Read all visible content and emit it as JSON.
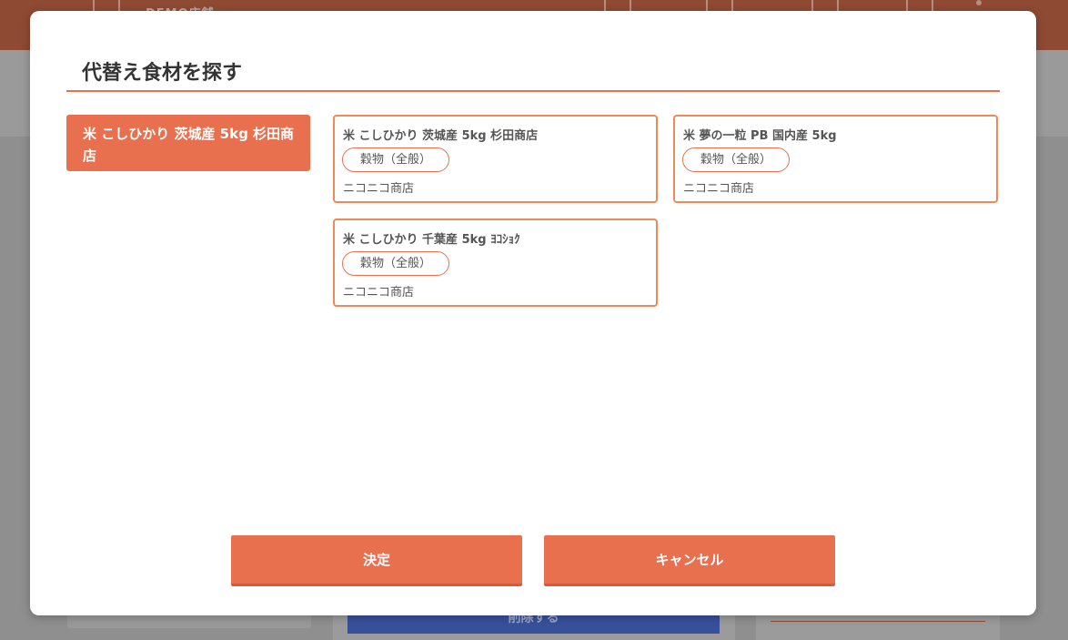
{
  "background": {
    "logo_text": "DEMO店舗",
    "delete_button_label": "削除する"
  },
  "modal": {
    "title": "代替え食材を探す",
    "selected_item": "米 こしひかり 茨城産 5kg 杉田商店",
    "cards": [
      {
        "name": "米 こしひかり 茨城産 5kg 杉田商店",
        "category": "穀物（全般）",
        "shop": "ニコニコ商店"
      },
      {
        "name": "米 夢の一粒 PB 国内産 5kg",
        "category": "穀物（全般）",
        "shop": "ニコニコ商店"
      },
      {
        "name": "米 こしひかり 千葉産 5kg ﾖｺｼｮｸ",
        "category": "穀物（全般）",
        "shop": "ニコニコ商店"
      }
    ],
    "confirm_label": "決定",
    "cancel_label": "キャンセル"
  },
  "colors": {
    "accent": "#e8704f",
    "card_border": "#ee8a5a",
    "header_dimmed": "#8e4a33",
    "overlay": "#8f8f8f"
  }
}
